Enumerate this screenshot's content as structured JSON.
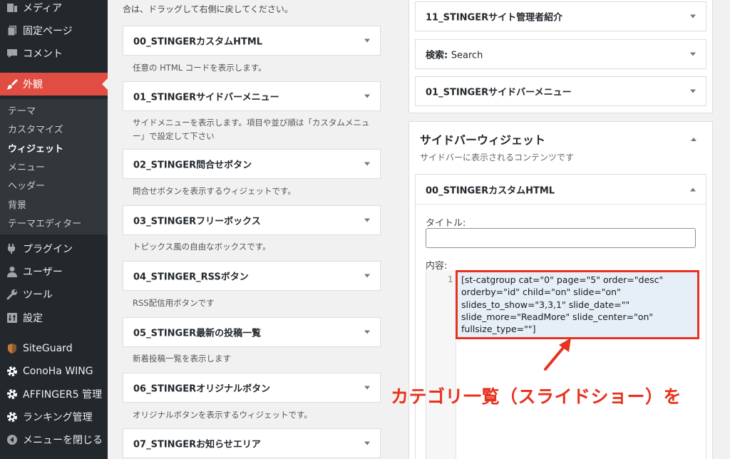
{
  "sidebar": {
    "top_items": [
      {
        "label": "メディア",
        "icon": "media-icon"
      },
      {
        "label": "固定ページ",
        "icon": "page-icon"
      },
      {
        "label": "コメント",
        "icon": "comment-icon"
      }
    ],
    "active_item": {
      "label": "外観",
      "icon": "appearance-brush-icon"
    },
    "submenu": [
      "テーマ",
      "カスタマイズ",
      "ウィジェット",
      "メニュー",
      "ヘッダー",
      "背景",
      "テーマエディター"
    ],
    "current_submenu": "ウィジェット",
    "bottom_items": [
      {
        "label": "プラグイン",
        "icon": "plugin-icon"
      },
      {
        "label": "ユーザー",
        "icon": "user-icon"
      },
      {
        "label": "ツール",
        "icon": "wrench-icon"
      },
      {
        "label": "設定",
        "icon": "settings-icon"
      },
      {
        "label": "SiteGuard",
        "icon": "siteguard-icon"
      },
      {
        "label": "ConoHa WING",
        "icon": "gear-icon"
      },
      {
        "label": "AFFINGER5 管理",
        "icon": "gear-icon"
      },
      {
        "label": "ランキング管理",
        "icon": "gear-icon"
      },
      {
        "label": "メニューを閉じる",
        "icon": "collapse-menu-icon"
      }
    ]
  },
  "available": {
    "intro": "合は、ドラッグして右側に戻してください。",
    "widgets": [
      {
        "title": "00_STINGERカスタムHTML",
        "desc": "任意の HTML コードを表示します。"
      },
      {
        "title": "01_STINGERサイドバーメニュー",
        "desc": "サイドメニューを表示します。項目や並び順は「カスタムメニュー」で設定して下さい"
      },
      {
        "title": "02_STINGER問合せボタン",
        "desc": "問合せボタンを表示するウィジェットです。"
      },
      {
        "title": "03_STINGERフリーボックス",
        "desc": "トピックス風の自由なボックスです。"
      },
      {
        "title": "04_STINGER_RSSボタン",
        "desc": "RSS配信用ボタンです"
      },
      {
        "title": "05_STINGER最新の投稿一覧",
        "desc": "新着投稿一覧を表示します"
      },
      {
        "title": "06_STINGERオリジナルボタン",
        "desc": "オリジナルボタンを表示するウィジェットです。"
      },
      {
        "title": "07_STINGERお知らせエリア",
        "desc": ""
      }
    ]
  },
  "right": {
    "top_widgets": [
      {
        "title": "11_STINGERサイト管理者紹介",
        "suffix": ""
      },
      {
        "title": "検索: ",
        "suffix": "Search"
      },
      {
        "title": "01_STINGERサイドバーメニュー",
        "suffix": ""
      }
    ],
    "area_title": "サイドバーウィジェット",
    "area_desc": "サイドバーに表示されるコンテンツです",
    "open_widget": {
      "title": "00_STINGERカスタムHTML",
      "title_label": "タイトル:",
      "title_value": "",
      "content_label": "内容:",
      "line_number": "1",
      "code_lines": [
        "[st-catgroup cat=\"0\" page=\"5\" order=\"desc\"",
        "orderby=\"id\" child=\"on\" slide=\"on\"",
        "slides_to_show=\"3,3,1\" slide_date=\"\"",
        "slide_more=\"ReadMore\" slide_center=\"on\"",
        "fullsize_type=\"\"]"
      ]
    }
  },
  "annotation": {
    "text": "カテゴリ一覧（スライドショー）を",
    "color": "#e8321e"
  }
}
